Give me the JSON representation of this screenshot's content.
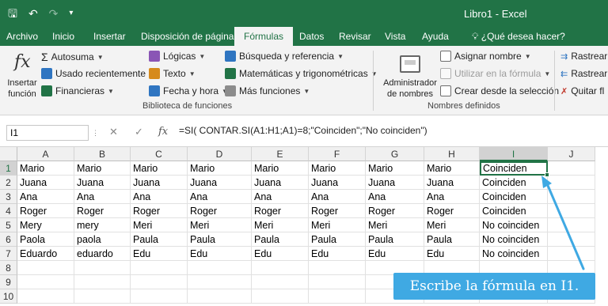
{
  "window": {
    "title": "Libro1  -  Excel"
  },
  "tabs": [
    "Archivo",
    "Inicio",
    "Insertar",
    "Disposición de página",
    "Fórmulas",
    "Datos",
    "Revisar",
    "Vista",
    "Ayuda"
  ],
  "active_tab": "Fórmulas",
  "tell_me": "¿Qué desea hacer?",
  "ribbon": {
    "insert_function": "Insertar\nfunción",
    "autosuma": "Autosuma",
    "usado_recientemente": "Usado recientemente",
    "financieras": "Financieras",
    "logicas": "Lógicas",
    "texto": "Texto",
    "fecha_hora": "Fecha y hora",
    "busqueda": "Búsqueda y referencia",
    "matematicas": "Matemáticas y trigonométricas",
    "mas_funciones": "Más funciones",
    "group_biblioteca": "Biblioteca de funciones",
    "administrador": "Administrador\nde nombres",
    "asignar_nombre": "Asignar nombre",
    "utilizar_formula": "Utilizar en la fórmula",
    "crear_seleccion": "Crear desde la selección",
    "group_nombres": "Nombres definidos",
    "rastrear1": "Rastrear",
    "rastrear2": "Rastrear",
    "quitar": "Quitar fl"
  },
  "formula_bar": {
    "name_box": "I1",
    "cancel": "✕",
    "enter": "✓",
    "fx": "fx",
    "formula": "=SI( CONTAR.SI(A1:H1;A1)=8;\"Coinciden\";\"No coinciden\")"
  },
  "columns": [
    "A",
    "B",
    "C",
    "D",
    "E",
    "F",
    "G",
    "H",
    "I",
    "J"
  ],
  "row_numbers": [
    "1",
    "2",
    "3",
    "4",
    "5",
    "6",
    "7",
    "8",
    "9",
    "10"
  ],
  "rows": [
    [
      "Mario",
      "Mario",
      "Mario",
      "Mario",
      "Mario",
      "Mario",
      "Mario",
      "Mario",
      "Coinciden"
    ],
    [
      "Juana",
      "Juana",
      "Juana",
      "Juana",
      "Juana",
      "Juana",
      "Juana",
      "Juana",
      "Coinciden"
    ],
    [
      "Ana",
      "Ana",
      "Ana",
      "Ana",
      "Ana",
      "Ana",
      "Ana",
      "Ana",
      "Coinciden"
    ],
    [
      "Roger",
      "Roger",
      "Roger",
      "Roger",
      "Roger",
      "Roger",
      "Roger",
      "Roger",
      "Coinciden"
    ],
    [
      "Mery",
      "mery",
      "Meri",
      "Meri",
      "Meri",
      "Meri",
      "Meri",
      "Meri",
      "No coinciden"
    ],
    [
      "Paola",
      "paola",
      "Paula",
      "Paula",
      "Paula",
      "Paula",
      "Paula",
      "Paula",
      "No coinciden"
    ],
    [
      "Eduardo",
      "eduardo",
      "Edu",
      "Edu",
      "Edu",
      "Edu",
      "Edu",
      "Edu",
      "No coinciden"
    ]
  ],
  "active_cell": "I1",
  "callout": "Escribe la fórmula en I1.",
  "colors": {
    "excel_green": "#217346",
    "callout_blue": "#3fa9e3"
  }
}
